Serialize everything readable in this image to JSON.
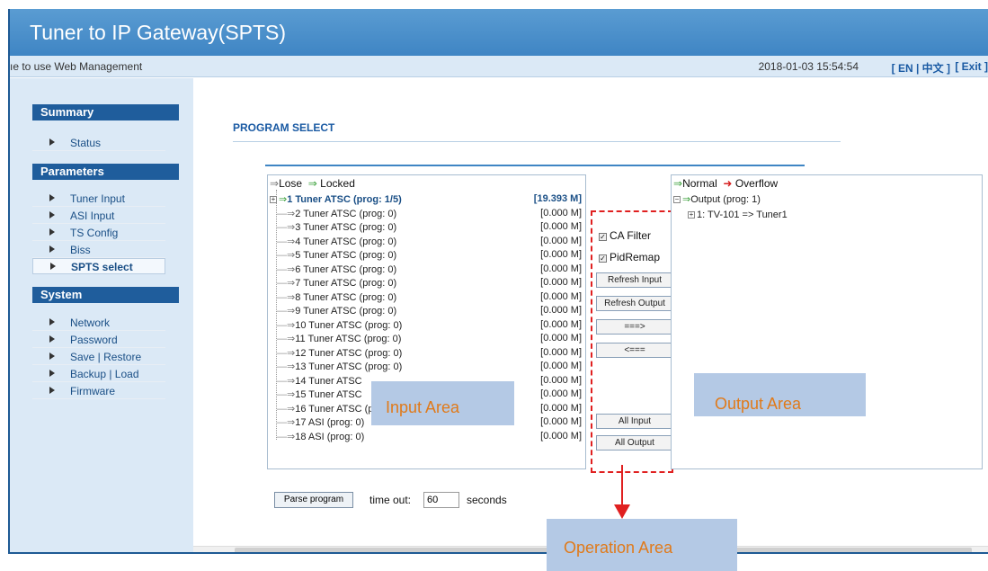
{
  "header": {
    "title": "Tuner to IP Gateway(SPTS)",
    "welcome": "ıe to use Web Management",
    "datetime": "2018-01-03 15:54:54",
    "language": "[ EN | 中文 ]",
    "exit": "[ Exit ]"
  },
  "sidebar": {
    "sections": [
      {
        "title": "Summary",
        "items": [
          "Status"
        ]
      },
      {
        "title": "Parameters",
        "items": [
          "Tuner Input",
          "ASI Input",
          "TS Config",
          "Biss",
          "SPTS select"
        ]
      },
      {
        "title": "System",
        "items": [
          "Network",
          "Password",
          "Save | Restore",
          "Backup | Load",
          "Firmware"
        ]
      }
    ],
    "active_item": "SPTS select"
  },
  "main": {
    "title": "PROGRAM SELECT",
    "input_panel": {
      "legend_lose": "Lose",
      "legend_locked": "Locked",
      "rows": [
        {
          "label": "1 Tuner ATSC (prog: 1/5)",
          "rate": "[19.393 M]"
        },
        {
          "label": "2 Tuner ATSC (prog: 0)",
          "rate": "[0.000 M]"
        },
        {
          "label": "3 Tuner ATSC (prog: 0)",
          "rate": "[0.000 M]"
        },
        {
          "label": "4 Tuner ATSC (prog: 0)",
          "rate": "[0.000 M]"
        },
        {
          "label": "5 Tuner ATSC (prog: 0)",
          "rate": "[0.000 M]"
        },
        {
          "label": "6 Tuner ATSC (prog: 0)",
          "rate": "[0.000 M]"
        },
        {
          "label": "7 Tuner ATSC (prog: 0)",
          "rate": "[0.000 M]"
        },
        {
          "label": "8 Tuner ATSC (prog: 0)",
          "rate": "[0.000 M]"
        },
        {
          "label": "9 Tuner ATSC (prog: 0)",
          "rate": "[0.000 M]"
        },
        {
          "label": "10 Tuner ATSC (prog: 0)",
          "rate": "[0.000 M]"
        },
        {
          "label": "11 Tuner ATSC (prog: 0)",
          "rate": "[0.000 M]"
        },
        {
          "label": "12 Tuner ATSC (prog: 0)",
          "rate": "[0.000 M]"
        },
        {
          "label": "13 Tuner ATSC (prog: 0)",
          "rate": "[0.000 M]"
        },
        {
          "label": "14 Tuner ATSC",
          "rate": "[0.000 M]"
        },
        {
          "label": "15 Tuner ATSC",
          "rate": "[0.000 M]"
        },
        {
          "label": "16 Tuner ATSC (prog: 0)",
          "rate": "[0.000 M]"
        },
        {
          "label": "17 ASI (prog: 0)",
          "rate": "[0.000 M]"
        },
        {
          "label": "18 ASI (prog: 0)",
          "rate": "[0.000 M]"
        }
      ]
    },
    "operations": {
      "ca_filter": "CA Filter",
      "pid_remap": "PidRemap",
      "refresh_input": "Refresh Input",
      "refresh_output": "Refresh Output",
      "add": "===>",
      "remove": "<===",
      "all_input": "All Input",
      "all_output": "All Output"
    },
    "output_panel": {
      "legend_normal": "Normal",
      "legend_overflow": "Overflow",
      "root": "Output (prog: 1)",
      "child": "1: TV-101 => Tuner1"
    },
    "parse": {
      "button": "Parse program",
      "timeout_label": "time out:",
      "timeout_value": "60",
      "seconds": "seconds"
    }
  },
  "annotations": {
    "input_area": "Input Area",
    "output_area": "Output Area",
    "operation_area": "Operation Area"
  },
  "colors": {
    "header_blue": "#3f85c4",
    "section_blue": "#1f5d9c",
    "callout_bg": "#b4c9e5",
    "callout_text": "#e07a1a",
    "dash_red": "#e02020"
  }
}
